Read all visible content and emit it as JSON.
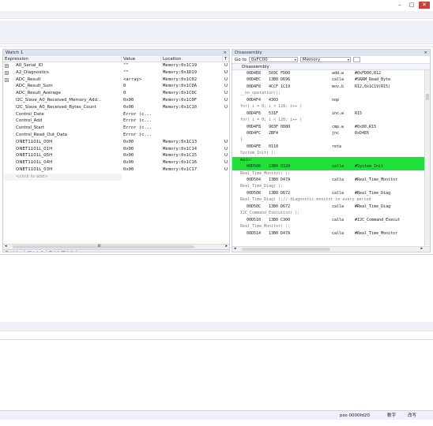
{
  "window_controls": {
    "minimize": "–",
    "maximize": "□",
    "close": "✕"
  },
  "watch": {
    "title": "Watch 1",
    "close": "×",
    "columns": [
      "Expression",
      "Value",
      "Location",
      "T"
    ],
    "rows": [
      {
        "exp": "A0_Serial_ID",
        "val": "\"\"",
        "loc": "Memory:0x1C19",
        "t": "U",
        "expand": "+"
      },
      {
        "exp": "A2_Diagnostics",
        "val": "\"\"",
        "loc": "Memory:0x1D19",
        "t": "U",
        "expand": "+"
      },
      {
        "exp": "ADC_Result",
        "val": "<array>",
        "loc": "Memory:0x1C02",
        "t": "U",
        "expand": "+"
      },
      {
        "exp": "ADC_Result_Sum",
        "val": "0",
        "loc": "Memory:0x1C0A",
        "t": "U",
        "expand": ""
      },
      {
        "exp": "ADC_Result_Average",
        "val": "0",
        "loc": "Memory:0x1C0C",
        "t": "U",
        "expand": ""
      },
      {
        "exp": "I2C_Slave_A0_Received_Memory_Add...",
        "val": "0x00",
        "loc": "Memory:0x1C0F",
        "t": "U",
        "expand": ""
      },
      {
        "exp": "I2C_Slave_A0_Received_Bytes_Count",
        "val": "0x00",
        "loc": "Memory:0x1C10",
        "t": "U",
        "expand": ""
      },
      {
        "exp": "Control_Date",
        "val": "Error (c...",
        "loc": "",
        "t": "",
        "expand": ""
      },
      {
        "exp": "Control_Add",
        "val": "Error (c...",
        "loc": "",
        "t": "",
        "expand": ""
      },
      {
        "exp": "Control_Start",
        "val": "Error (c...",
        "loc": "",
        "t": "",
        "expand": ""
      },
      {
        "exp": "Control_Read_Out_Data",
        "val": "Error (c...",
        "loc": "",
        "t": "",
        "expand": ""
      },
      {
        "exp": "ONET1101L_00H",
        "val": "0x00",
        "loc": "Memory:0x1C13",
        "t": "U",
        "expand": ""
      },
      {
        "exp": "ONET1101L_01H",
        "val": "0x00",
        "loc": "Memory:0x1C14",
        "t": "U",
        "expand": ""
      },
      {
        "exp": "ONET1101L_05H",
        "val": "0x00",
        "loc": "Memory:0x1C15",
        "t": "U",
        "expand": ""
      },
      {
        "exp": "ONET1101L_04H",
        "val": "0x00",
        "loc": "Memory:0x1C16",
        "t": "U",
        "expand": ""
      },
      {
        "exp": "ONET1101L_03H",
        "val": "0x00",
        "loc": "Memory:0x1C17",
        "t": "U",
        "expand": ""
      }
    ],
    "add_placeholder": "<click to add>",
    "scroll_left": "◂",
    "scroll_right": "▸",
    "scroll_grip": "III",
    "tabs": [
      "Register",
      "Watch 1",
      "Quick Watch"
    ],
    "active_tab": 1
  },
  "disassembly": {
    "title": "Disassembly",
    "close": "×",
    "goto_label": "Go to",
    "goto_value": "0xFC00",
    "memory_select": "Memory",
    "sub_header": "Disassembly",
    "lines": [
      {
        "kind": "code",
        "addr": "00D4E8",
        "code": "503C FD00",
        "mn": "add.w",
        "op": "#0xFD00,R12"
      },
      {
        "kind": "code",
        "addr": "00D4EC",
        "code": "13B0 D696",
        "mn": "calla",
        "op": "#SRAM_Read_Byte"
      },
      {
        "kind": "code",
        "addr": "00D4F0",
        "code": "4CCF 1C19",
        "mn": "mov.b",
        "op": "R12,0x1C19(R15)"
      },
      {
        "kind": "src",
        "text": "__no_operation();"
      },
      {
        "kind": "code",
        "addr": "00D4F4",
        "code": "4303",
        "mn": "nop",
        "op": ""
      },
      {
        "kind": "src",
        "text": "for( i = 0; i < 128; i++ )"
      },
      {
        "kind": "code",
        "addr": "00D4F6",
        "code": "531F",
        "mn": "inc.w",
        "op": "R15"
      },
      {
        "kind": "src",
        "text": "for( i = 0; i < 128; i++ )"
      },
      {
        "kind": "code",
        "addr": "00D4F8",
        "code": "903F 0080",
        "mn": "cmp.w",
        "op": "#0x80,R15"
      },
      {
        "kind": "code",
        "addr": "00D4FC",
        "code": "2BF4",
        "mn": "jnc",
        "op": "0xD4E6"
      },
      {
        "kind": "src",
        "text": "}"
      },
      {
        "kind": "code",
        "addr": "00D4FE",
        "code": "0110",
        "mn": "reta",
        "op": ""
      },
      {
        "kind": "src",
        "text": "System_Init( );"
      },
      {
        "kind": "hl",
        "text": "main:"
      },
      {
        "kind": "code-hl",
        "addr": "00D500",
        "code": "13B0 D320",
        "mn": "calla",
        "op": "#System_Init"
      },
      {
        "kind": "src",
        "text": "Real_Time_Monitor( );"
      },
      {
        "kind": "code",
        "addr": "00D504",
        "code": "13B0 D47A",
        "mn": "calla",
        "op": "#Real_Time_Monitor"
      },
      {
        "kind": "src",
        "text": "Real_Time_Diag( );"
      },
      {
        "kind": "code",
        "addr": "00D508",
        "code": "13B0 D672",
        "mn": "calla",
        "op": "#Real_Time_Diag"
      },
      {
        "kind": "src",
        "text": "Real_Time_Diag( );// diagnostic monitor in every period"
      },
      {
        "kind": "code",
        "addr": "00D50C",
        "code": "13B0 D672",
        "mn": "calla",
        "op": "#Real_Time_Diag"
      },
      {
        "kind": "src",
        "text": "I2C_Command_Execution( );"
      },
      {
        "kind": "code",
        "addr": "00D510",
        "code": "13B0 C300",
        "mn": "calla",
        "op": "#I2C_Command_Execut"
      },
      {
        "kind": "src",
        "text": "Real_Time_Monitor( );"
      },
      {
        "kind": "code",
        "addr": "00D514",
        "code": "13B0 D47A",
        "mn": "calla",
        "op": "#Real_Time_Monitor"
      }
    ]
  },
  "status": {
    "position": "pos 0000fd20",
    "field1": "数字",
    "field2": "改写"
  },
  "colors": {
    "highlight": "#22e03a",
    "panel_title": "#dde3ef",
    "strip": "#eef1f8"
  },
  "icons": [
    "minimize-icon",
    "maximize-icon",
    "close-icon",
    "expand-icon",
    "dropdown-arrow-icon",
    "memory-view-icon",
    "scroll-left-icon",
    "scroll-right-icon"
  ]
}
